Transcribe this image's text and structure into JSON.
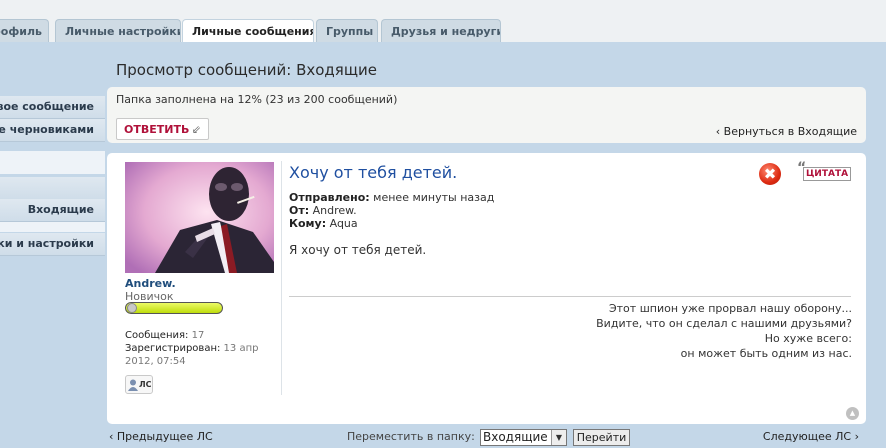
{
  "tabs": [
    {
      "label": "Профиль",
      "active": false
    },
    {
      "label": "Личные настройки",
      "active": false
    },
    {
      "label": "Личные сообщения",
      "active": true
    },
    {
      "label": "Группы",
      "active": false
    },
    {
      "label": "Друзья и недруги",
      "active": false
    }
  ],
  "sidebar": {
    "items": [
      {
        "label": "Новое сообщение"
      },
      {
        "label": "Управление черновиками"
      },
      {
        "label": "Входящие"
      },
      {
        "label": "Папки и настройки"
      }
    ]
  },
  "page": {
    "title": "Просмотр сообщений: Входящие"
  },
  "toolbar": {
    "folder_status": "Папка заполнена на 12% (23 из 200 сообщений)",
    "reply_label": "ОТВЕТИТЬ",
    "reply_arrow": "⇙",
    "back_label": "‹ Вернуться в Входящие"
  },
  "message": {
    "subject": "Хочу от тебя детей.",
    "sent_label": "Отправлено:",
    "sent_value": "менее минуты назад",
    "from_label": "От:",
    "from_value": "Andrew.",
    "to_label": "Кому:",
    "to_value": "Aqua",
    "body": "Я хочу от тебя детей.",
    "delete_glyph": "✖",
    "quote_mark": "“",
    "quote_label": "ЦИТАТА",
    "signature": [
      "Этот шпион уже прорвал нашу оборону...",
      "Видите, что он сделал с нашими друзьями?",
      "Но хуже всего:",
      "он может быть одним из нас."
    ]
  },
  "author": {
    "name": "Andrew.",
    "rank": "Новичок",
    "posts_label": "Сообщения:",
    "posts_value": "17",
    "registered_label": "Зарегистрирован:",
    "registered_value": "13 апр 2012, 07:54",
    "pm_label": "ЛС"
  },
  "bottom": {
    "prev": "‹ Предыдущее ЛС",
    "next": "Следующее ЛС ›",
    "move_label": "Переместить в папку:",
    "move_selected": "Входящие",
    "go_label": "Перейти"
  },
  "colors": {
    "accent": "#b0113a",
    "link": "#1f4fa0",
    "panel": "#c4d7e8"
  }
}
